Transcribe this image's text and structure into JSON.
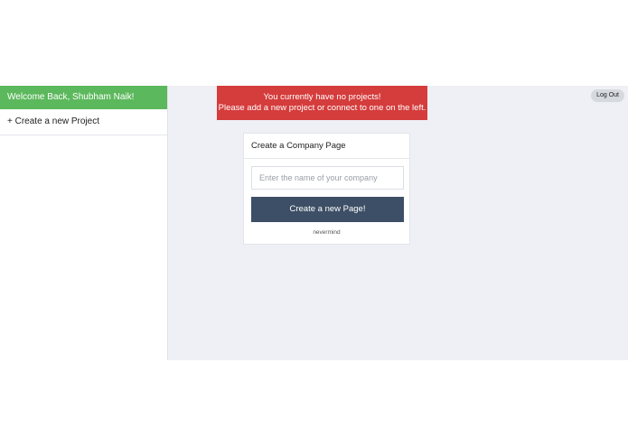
{
  "sidebar": {
    "welcome": "Welcome Back, Shubham Naik!",
    "new_project": "+ Create a new Project"
  },
  "alert": {
    "line1": "You currently have no projects!",
    "line2": "Please add a new project or connect to one on the left."
  },
  "header": {
    "logout": "Log Out"
  },
  "card": {
    "title": "Create a Company Page",
    "input_placeholder": "Enter the name of your company",
    "input_value": "",
    "create_button": "Create a new Page!",
    "nevermind": "nevermind"
  },
  "colors": {
    "welcome_bg": "#5cb85c",
    "alert_bg": "#d53c3c",
    "button_bg": "#3d4f66",
    "content_bg": "#eef0f5"
  }
}
